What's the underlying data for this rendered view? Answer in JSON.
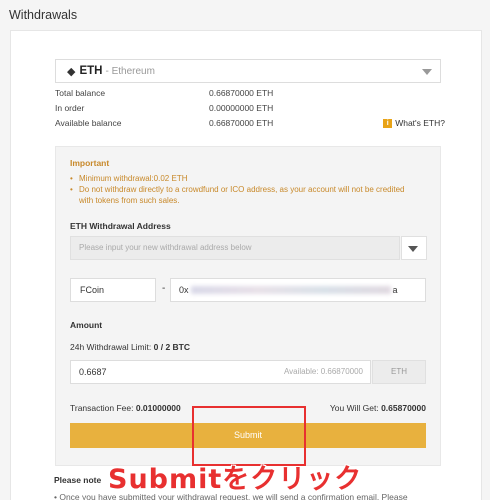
{
  "page": {
    "title": "Withdrawals"
  },
  "coin_select": {
    "symbol": "ETH",
    "name": "- Ethereum",
    "icon": "ethereum-icon"
  },
  "balances": [
    {
      "label": "Total balance",
      "value": "0.66870000 ETH"
    },
    {
      "label": "In order",
      "value": "0.00000000 ETH"
    },
    {
      "label": "Available balance",
      "value": "0.66870000 ETH"
    }
  ],
  "whats_link": "What's ETH?",
  "important": {
    "title": "Important",
    "items": [
      "Minimum withdrawal:0.02 ETH",
      "Do not withdraw directly to a crowdfund or ICO address, as your account will not be credited with tokens from such sales."
    ]
  },
  "address": {
    "label": "ETH Withdrawal Address",
    "placeholder": "Please input your new withdrawal address below",
    "tag_value": "FCoin",
    "dash": "-",
    "value_prefix": "0x",
    "value_suffix": "a"
  },
  "amount": {
    "label": "Amount",
    "limit_prefix": "24h Withdrawal Limit:",
    "limit_value": "0 / 2 BTC",
    "value": "0.6687",
    "available": "Available: 0.66870000",
    "unit": "ETH"
  },
  "fee": {
    "label": "Transaction Fee:",
    "value": "0.01000000"
  },
  "receive": {
    "label": "You Will Get:",
    "value": "0.65870000"
  },
  "submit_label": "Submit",
  "note": {
    "title": "Please note",
    "item": "Once you have submitted your withdrawal request, we will send a confirmation email. Please"
  },
  "overlay_text": "Submitをクリック",
  "colors": {
    "accent": "#e8b13e",
    "warning": "#c8892a",
    "annotation": "#e83030"
  }
}
